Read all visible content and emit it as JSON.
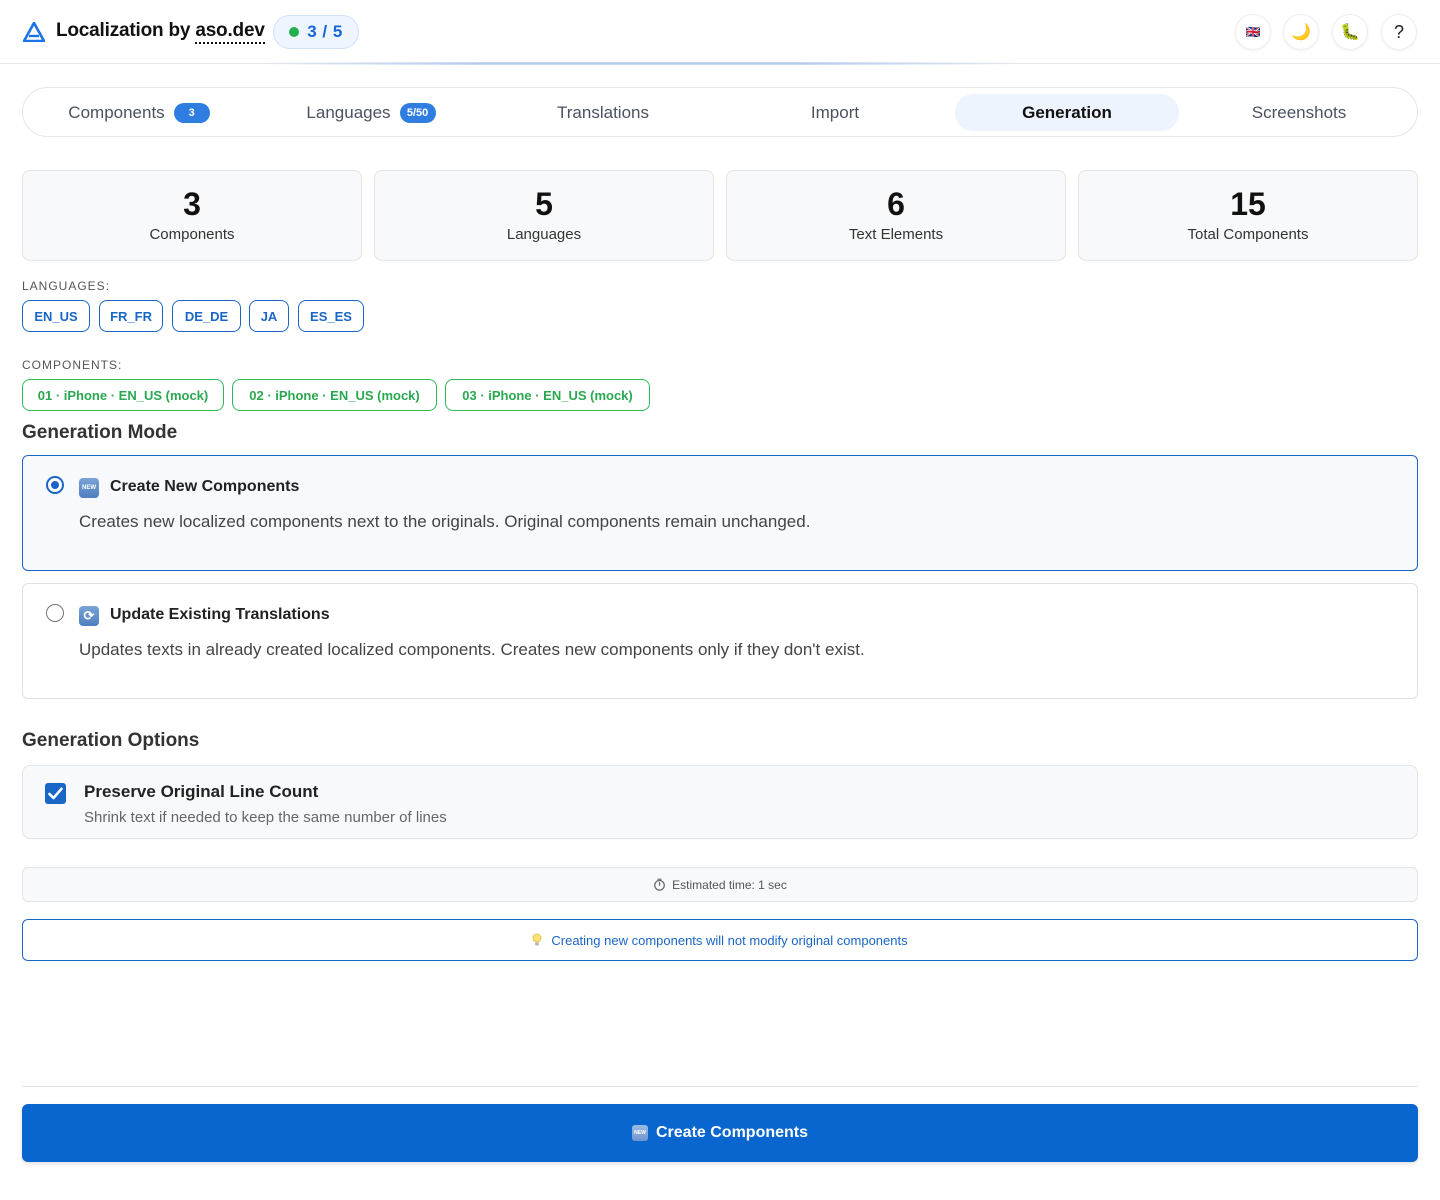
{
  "header": {
    "title_prefix": "Localization by ",
    "title_brand": "aso.dev",
    "status": "3 / 5",
    "status_color": "#22b04f",
    "buttons": [
      {
        "icon": "flag-uk-icon",
        "glyph": "🇬🇧"
      },
      {
        "icon": "moon-icon",
        "glyph": "🌙"
      },
      {
        "icon": "bug-icon",
        "glyph": "🐛"
      },
      {
        "icon": "help-icon",
        "glyph": "?"
      }
    ]
  },
  "tabs": [
    {
      "label": "Components",
      "badge": "3"
    },
    {
      "label": "Languages",
      "badge": "5/50"
    },
    {
      "label": "Translations"
    },
    {
      "label": "Import"
    },
    {
      "label": "Generation",
      "active": true
    },
    {
      "label": "Screenshots"
    }
  ],
  "stats": [
    {
      "value": "3",
      "label": "Components"
    },
    {
      "value": "5",
      "label": "Languages"
    },
    {
      "value": "6",
      "label": "Text Elements"
    },
    {
      "value": "15",
      "label": "Total Components"
    }
  ],
  "languages": {
    "caption": "LANGUAGES:",
    "items": [
      "EN_US",
      "FR_FR",
      "DE_DE",
      "JA",
      "ES_ES"
    ]
  },
  "components": {
    "caption": "COMPONENTS:",
    "items": [
      "01 · iPhone · EN_US (mock)",
      "02 · iPhone · EN_US (mock)",
      "03 · iPhone · EN_US (mock)"
    ]
  },
  "generation_mode": {
    "heading": "Generation Mode",
    "options": [
      {
        "title": "Create New Components",
        "description": "Creates new localized components next to the originals. Original components remain unchanged.",
        "icon": "new-icon",
        "selected": true
      },
      {
        "title": "Update Existing Translations",
        "description": "Updates texts in already created localized components. Creates new components only if they don't exist.",
        "icon": "refresh-icon",
        "selected": false
      }
    ]
  },
  "generation_options": {
    "heading": "Generation Options",
    "preserve": {
      "title": "Preserve Original Line Count",
      "description": "Shrink text if needed to keep the same number of lines",
      "checked": true
    }
  },
  "estimate": "Estimated time: 1 sec",
  "note": "Creating new components will not modify original components",
  "primary_button": "Create Components",
  "colors": {
    "accent": "#0a66cf",
    "component_chip": "#2dbb57"
  }
}
